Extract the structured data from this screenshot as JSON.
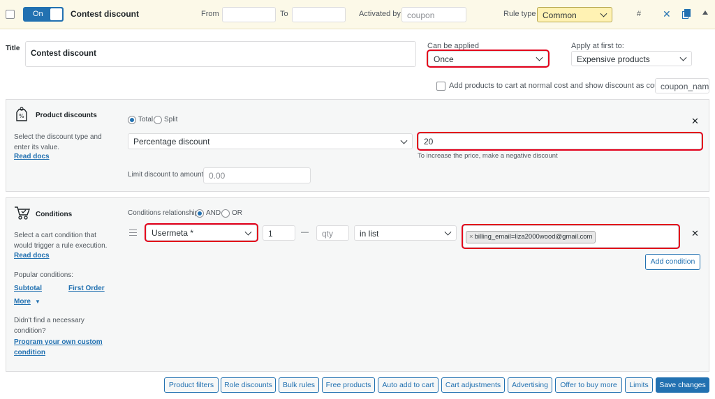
{
  "header": {
    "toggle_label": "On",
    "rule_name": "Contest discount",
    "from_label": "From",
    "to_label": "To",
    "activated_by_label": "Activated by",
    "activated_by_placeholder": "coupon",
    "rule_type_label": "Rule type",
    "rule_type_value": "Common",
    "hash_label": "#"
  },
  "title": {
    "label": "Title",
    "value": "Contest discount"
  },
  "can_be_applied": {
    "label": "Can be applied",
    "value": "Once"
  },
  "apply_first": {
    "label": "Apply at first to:",
    "value": "Expensive products"
  },
  "coupon_option": {
    "label": "Add products to cart at normal cost and show discount as coupon",
    "input_placeholder": "coupon_name"
  },
  "product_discounts": {
    "heading": "Product discounts",
    "description": "Select the discount type and enter its value.",
    "read_docs": "Read docs",
    "total_label": "Total",
    "split_label": "Split",
    "type_value": "Percentage discount",
    "amount_value": "20",
    "hint": "To increase the price, make a negative discount",
    "limit_label": "Limit discount to amount:",
    "limit_placeholder": "0.00"
  },
  "conditions": {
    "heading": "Conditions",
    "description": "Select a cart condition that would trigger a rule execution.",
    "read_docs": "Read docs",
    "popular_label": "Popular conditions:",
    "popular_items": [
      "Subtotal",
      "First Order"
    ],
    "more_label": "More",
    "not_found_text": "Didn't find a necessary condition?",
    "custom_link": "Program your own custom condition",
    "relationship_label": "Conditions relationship",
    "and_label": "AND",
    "or_label": "OR",
    "condition_type": "Usermeta *",
    "qty_value": "1",
    "dash": "—",
    "qty_placeholder": "qty",
    "operator_value": "in list",
    "tag_value": "billing_email=liza2000wood@gmail.com",
    "add_condition_label": "Add condition"
  },
  "footer_buttons": [
    "Product filters",
    "Role discounts",
    "Bulk rules",
    "Free products",
    "Auto add to cart",
    "Cart adjustments",
    "Advertising",
    "Offer to buy more",
    "Limits"
  ],
  "save_label": "Save changes",
  "colors": {
    "accent": "#2271b1",
    "highlight_border": "#e3001b",
    "header_bg": "#fcf9e8",
    "rule_type_bg": "#fff2b3"
  }
}
